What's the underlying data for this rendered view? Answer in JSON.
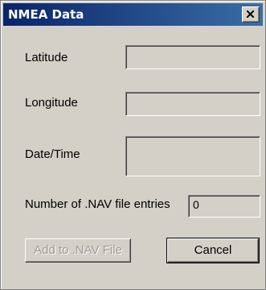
{
  "window": {
    "title": "NMEA Data",
    "close_glyph": "close-icon"
  },
  "fields": {
    "latitude_label": "Latitude",
    "latitude_value": "",
    "longitude_label": "Longitude",
    "longitude_value": "",
    "datetime_label": "Date/Time",
    "datetime_value": "",
    "nav_entries_label": "Number of .NAV file entries",
    "nav_entries_value": "0"
  },
  "buttons": {
    "add_label": "Add to .NAV File",
    "add_enabled": false,
    "cancel_label": "Cancel"
  },
  "colors": {
    "title_bar_start": "#0a246a",
    "title_bar_end": "#3a6ea5",
    "dialog_face": "#d4d0c8",
    "disabled_text": "#9c9a94"
  }
}
